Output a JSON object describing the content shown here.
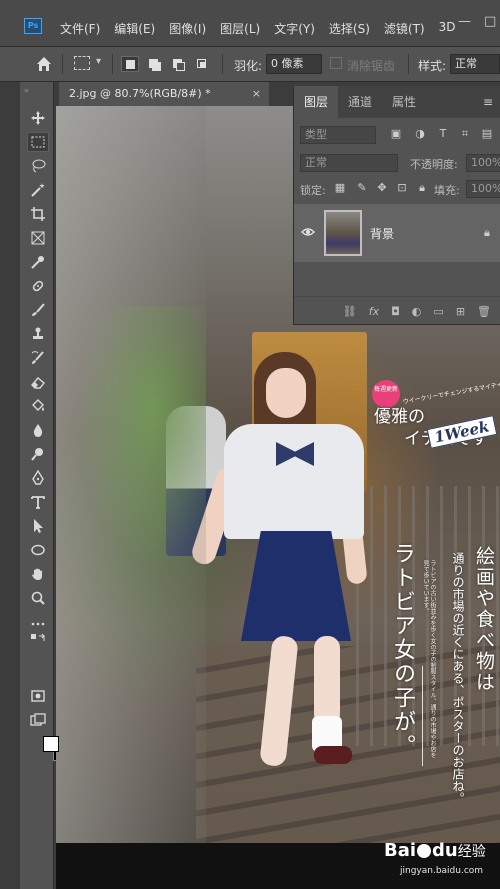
{
  "app": {
    "logo_text": "Ps"
  },
  "menu": {
    "items": [
      "文件(F)",
      "编辑(E)",
      "图像(I)",
      "图层(L)",
      "文字(Y)",
      "选择(S)",
      "滤镜(T)",
      "3D"
    ],
    "window_buttons": [
      "—",
      "□"
    ]
  },
  "options_bar": {
    "feather_label": "羽化:",
    "feather_value": "0 像素",
    "antialias_label": "消除锯齿",
    "style_label": "样式:",
    "style_value": "正常"
  },
  "document": {
    "tab_title": "2.jpg @ 80.7%(RGB/8#) *",
    "close_symbol": "×"
  },
  "layers_panel": {
    "tabs": [
      "图层",
      "通道",
      "属性"
    ],
    "filter_placeholder": "类型",
    "blend_mode": "正常",
    "opacity_label": "不透明度:",
    "opacity_value": "100%",
    "lock_label": "锁定:",
    "fill_label": "填充:",
    "fill_value": "100%",
    "layer_name": "背景",
    "footer_icons": [
      "link-icon",
      "fx-icon",
      "mask-icon",
      "adjustment-icon",
      "group-icon",
      "new-layer-icon",
      "delete-icon"
    ],
    "fx_text": "fx"
  },
  "photo_text": {
    "badge": "毎週更新",
    "small_top": "ウイークリーでチェンジするマイテイ",
    "top_line1": "優雅の",
    "top_week": "1Week",
    "top_line2": "イテムです",
    "vertical_main": "ラトビア女の子が。",
    "vertical_right": "絵画や食べ物は",
    "vertical_body": "通りの市場の近くにある、ポスターのお店ね。",
    "vertical_small": "ラトビアの古い街並みを歩く女の子の制服スタイル、通りの市場やお店を見て歩いています。"
  },
  "watermark": {
    "brand_a": "Bai",
    "brand_b": "du",
    "brand_cn": "经验",
    "url": "jingyan.baidu.com"
  }
}
